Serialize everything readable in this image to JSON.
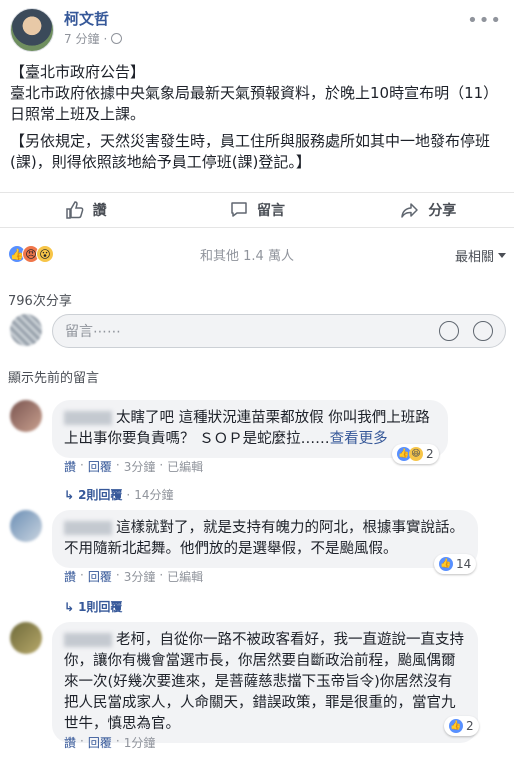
{
  "post": {
    "author": "柯文哲",
    "time": "7 分鐘",
    "more": "•••",
    "paragraphs": [
      "【臺北市政府公告】",
      "臺北市政府依據中央氣象局最新天氣預報資料，於晚上10時宣布明（11）日照常上班及上課。",
      "【另依規定，天然災害發生時，員工住所與服務處所如其中一地發布停班(課)，則得依照該地給予員工停班(課)登記。】"
    ]
  },
  "actions": {
    "like": "讚",
    "comment": "留言",
    "share": "分享"
  },
  "reactions": {
    "summary": "和其他 1.4 萬人",
    "sort": "最相關"
  },
  "shares": "796次分享",
  "composer": {
    "placeholder": "留言⋯⋯"
  },
  "prev_comments": "顯示先前的留言",
  "comments": [
    {
      "text": "太瞎了吧 這種狀況連苗栗都放假 你叫我們上班路上出事你要負責嗎？ ＳＯＰ是蛇麼拉……",
      "see_more": "查看更多",
      "reaction_count": "2",
      "like": "讚",
      "reply": "回覆",
      "time": "3分鐘",
      "edited": "已編輯",
      "replies": "2則回覆",
      "replies_time": "14分鐘"
    },
    {
      "text": "這樣就對了，就是支持有魄力的阿北，根據事實說話。不用隨新北起舞。他們放的是選舉假，不是颱風假。",
      "reaction_count": "14",
      "like": "讚",
      "reply": "回覆",
      "time": "3分鐘",
      "edited": "已編輯",
      "replies": "1則回覆"
    },
    {
      "text": "老柯，自從你一路不被政客看好，我一直遊說一直支持你，讓你有機會當選市長，你居然要自斷政治前程，颱風偶爾來一次(好幾次要進來，是菩薩慈悲擋下玉帝旨令)你居然沒有把人民當成家人，人命關天，錯誤政策，罪是很重的，當官九世牛，慎思為官。",
      "reaction_count": "2",
      "like": "讚",
      "reply": "回覆",
      "time": "1分鐘"
    }
  ],
  "colors": {
    "link": "#365899",
    "muted": "#90949c",
    "bubble": "#f2f3f5",
    "like_blue": "#5890ff"
  }
}
